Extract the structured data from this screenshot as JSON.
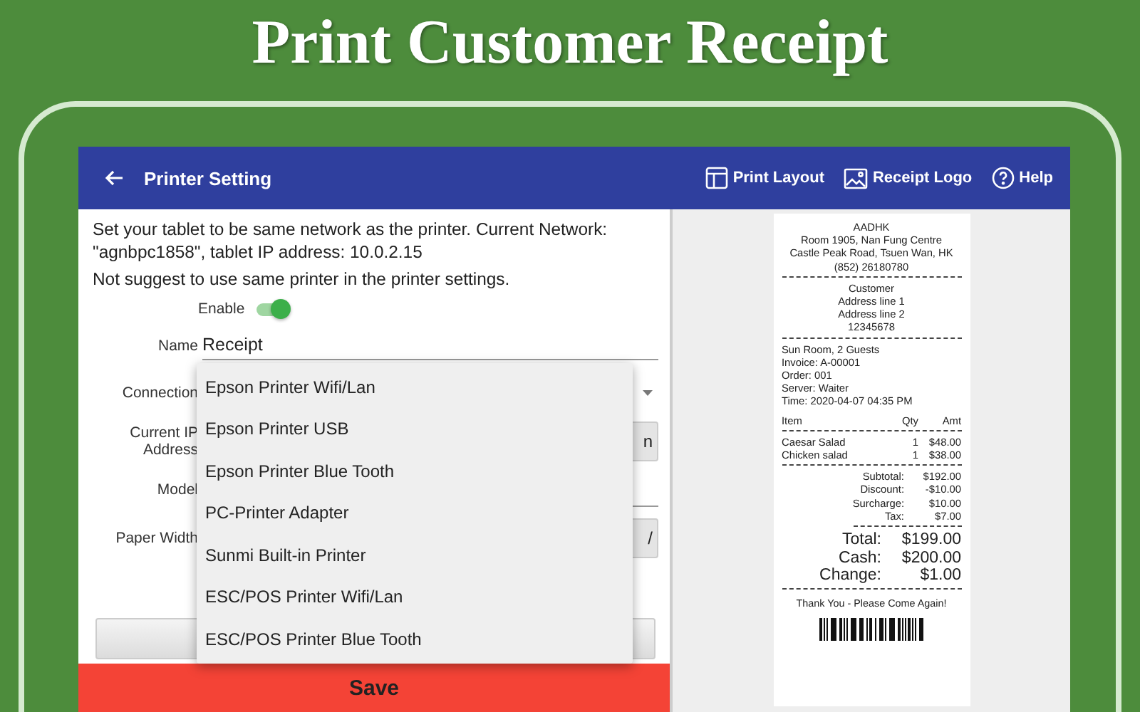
{
  "banner": {
    "title": "Print Customer Receipt"
  },
  "app_bar": {
    "title": "Printer Setting",
    "actions": [
      {
        "kind": "layout",
        "label": "Print Layout"
      },
      {
        "kind": "image",
        "label": "Receipt Logo"
      },
      {
        "kind": "help",
        "label": "Help"
      }
    ]
  },
  "notes": [
    "Set your tablet to be same network as the printer. Current Network: \"agnbpc1858\", tablet IP address: 10.0.2.15",
    "Not suggest to use same printer in the printer settings."
  ],
  "form": {
    "enable": {
      "label": "Enable",
      "on": true
    },
    "name": {
      "label": "Name",
      "value": "Receipt"
    },
    "connection": {
      "label": "Connection"
    },
    "ip": {
      "label": "Current IP Address",
      "button": "n"
    },
    "model": {
      "label": "Model"
    },
    "paper_width": {
      "label": "Paper Width",
      "button": "/"
    }
  },
  "dropdown": [
    "Epson Printer Wifi/Lan",
    "Epson Printer USB",
    "Epson Printer Blue Tooth",
    "PC-Printer Adapter",
    "Sunmi Built-in Printer",
    "ESC/POS Printer Wifi/Lan",
    "ESC/POS Printer Blue Tooth"
  ],
  "save_button": "Save",
  "receipt": {
    "header": [
      "AADHK",
      "Room 1905, Nan Fung Centre",
      "Castle Peak Road, Tsuen Wan, HK",
      "(852) 26180780"
    ],
    "customer": [
      "Customer",
      "Address line 1",
      "Address line 2",
      "12345678"
    ],
    "order": [
      "Sun Room, 2 Guests",
      "Invoice: A-00001",
      "Order: 001",
      "Server: Waiter",
      "Time: 2020-04-07 04:35 PM"
    ],
    "columns": [
      "Item",
      "Qty",
      "Amt"
    ],
    "items": [
      {
        "name": "Caesar Salad",
        "qty": "1",
        "amount": "$48.00"
      },
      {
        "name": "Chicken salad",
        "qty": "1",
        "amount": "$38.00"
      }
    ],
    "subtotals": [
      {
        "label": "Subtotal:",
        "value": "$192.00"
      },
      {
        "label": "Discount:",
        "value": "-$10.00"
      },
      {
        "label": "Surcharge:",
        "value": "$10.00"
      },
      {
        "label": "Tax:",
        "value": "$7.00"
      }
    ],
    "totals": [
      {
        "label": "Total:",
        "value": "$199.00"
      },
      {
        "label": "Cash:",
        "value": "$200.00"
      },
      {
        "label": "Change:",
        "value": "$1.00"
      }
    ],
    "footer": "Thank You - Please Come Again!"
  }
}
